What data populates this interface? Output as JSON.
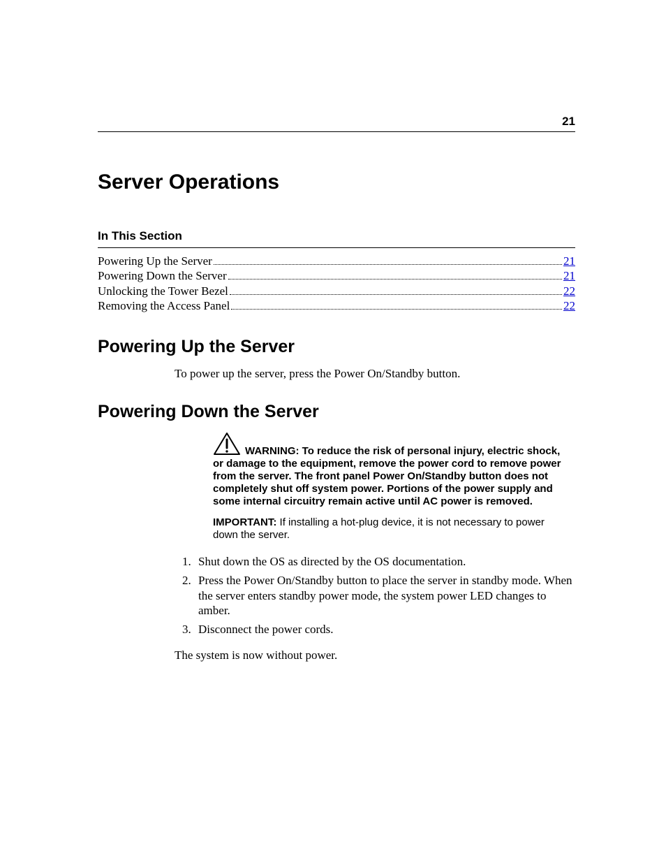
{
  "page_number": "21",
  "title": "Server Operations",
  "in_this_section_label": "In This Section",
  "toc": [
    {
      "title": "Powering Up the Server",
      "page": "21"
    },
    {
      "title": "Powering Down the Server",
      "page": "21"
    },
    {
      "title": "Unlocking the Tower Bezel",
      "page": "22"
    },
    {
      "title": "Removing the Access Panel ",
      "page": "22"
    }
  ],
  "section1": {
    "heading": "Powering Up the Server",
    "para": "To power up the server, press the Power On/Standby button."
  },
  "section2": {
    "heading": "Powering Down the Server",
    "warning_label": "WARNING:  ",
    "warning_text": "To reduce the risk of personal injury, electric shock, or damage to the equipment, remove the power cord to remove power from the server. The front panel Power On/Standby button does not completely shut off system power. Portions of the power supply and some internal circuitry remain active until AC power is removed.",
    "important_label": "IMPORTANT:  ",
    "important_text": "If installing a hot-plug device, it is not necessary to power down the server.",
    "steps": [
      "Shut down the OS as directed by the OS documentation.",
      "Press the Power On/Standby button to place the server in standby mode. When the server enters standby power mode, the system power LED changes to amber.",
      "Disconnect the power cords."
    ],
    "closing": "The system is now without power."
  }
}
